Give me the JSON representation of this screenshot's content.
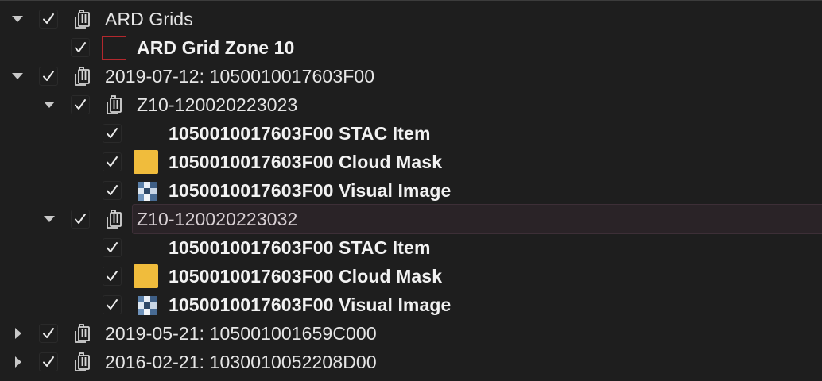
{
  "tree": {
    "nodes": [
      {
        "id": "ard-grids",
        "label": "ARD Grids",
        "expanded": true,
        "checked": true,
        "icon": "layer-group-icon"
      },
      {
        "id": "ard-grid-zone-10",
        "label": "ARD Grid Zone 10",
        "checked": true,
        "icon": "grid-outline-swatch",
        "swatch_color": "#b3282d",
        "bold": true
      },
      {
        "id": "date-2019-07-12",
        "label": "2019-07-12: 1050010017603F00",
        "expanded": true,
        "checked": true,
        "icon": "layer-group-icon"
      },
      {
        "id": "z10-023023",
        "label": "Z10-120020223023",
        "expanded": true,
        "checked": true,
        "icon": "layer-group-icon"
      },
      {
        "id": "z10-023023-stac",
        "label": "1050010017603F00 STAC Item",
        "checked": true,
        "icon": "none",
        "bold": true
      },
      {
        "id": "z10-023023-cloud",
        "label": "1050010017603F00 Cloud Mask",
        "checked": true,
        "icon": "fill-swatch",
        "swatch_color": "#f0bc3c",
        "bold": true
      },
      {
        "id": "z10-023023-visual",
        "label": "1050010017603F00 Visual Image",
        "checked": true,
        "icon": "raster-image-icon",
        "bold": true
      },
      {
        "id": "z10-023032",
        "label": "Z10-120020223032",
        "expanded": true,
        "checked": true,
        "icon": "layer-group-icon",
        "selected": true
      },
      {
        "id": "z10-023032-stac",
        "label": "1050010017603F00 STAC Item",
        "checked": true,
        "icon": "none",
        "bold": true
      },
      {
        "id": "z10-023032-cloud",
        "label": "1050010017603F00 Cloud Mask",
        "checked": true,
        "icon": "fill-swatch",
        "swatch_color": "#f0bc3c",
        "bold": true
      },
      {
        "id": "z10-023032-visual",
        "label": "1050010017603F00 Visual Image",
        "checked": true,
        "icon": "raster-image-icon",
        "bold": true
      },
      {
        "id": "date-2019-05-21",
        "label": "2019-05-21: 105001001659C000",
        "expanded": false,
        "checked": true,
        "icon": "layer-group-icon"
      },
      {
        "id": "date-2016-02-21",
        "label": "2016-02-21: 1030010052208D00",
        "expanded": false,
        "checked": true,
        "icon": "layer-group-icon"
      }
    ]
  },
  "colors": {
    "background": "#1e1e1e",
    "text": "#e6e6e6",
    "selected_row": "#2a2327"
  }
}
